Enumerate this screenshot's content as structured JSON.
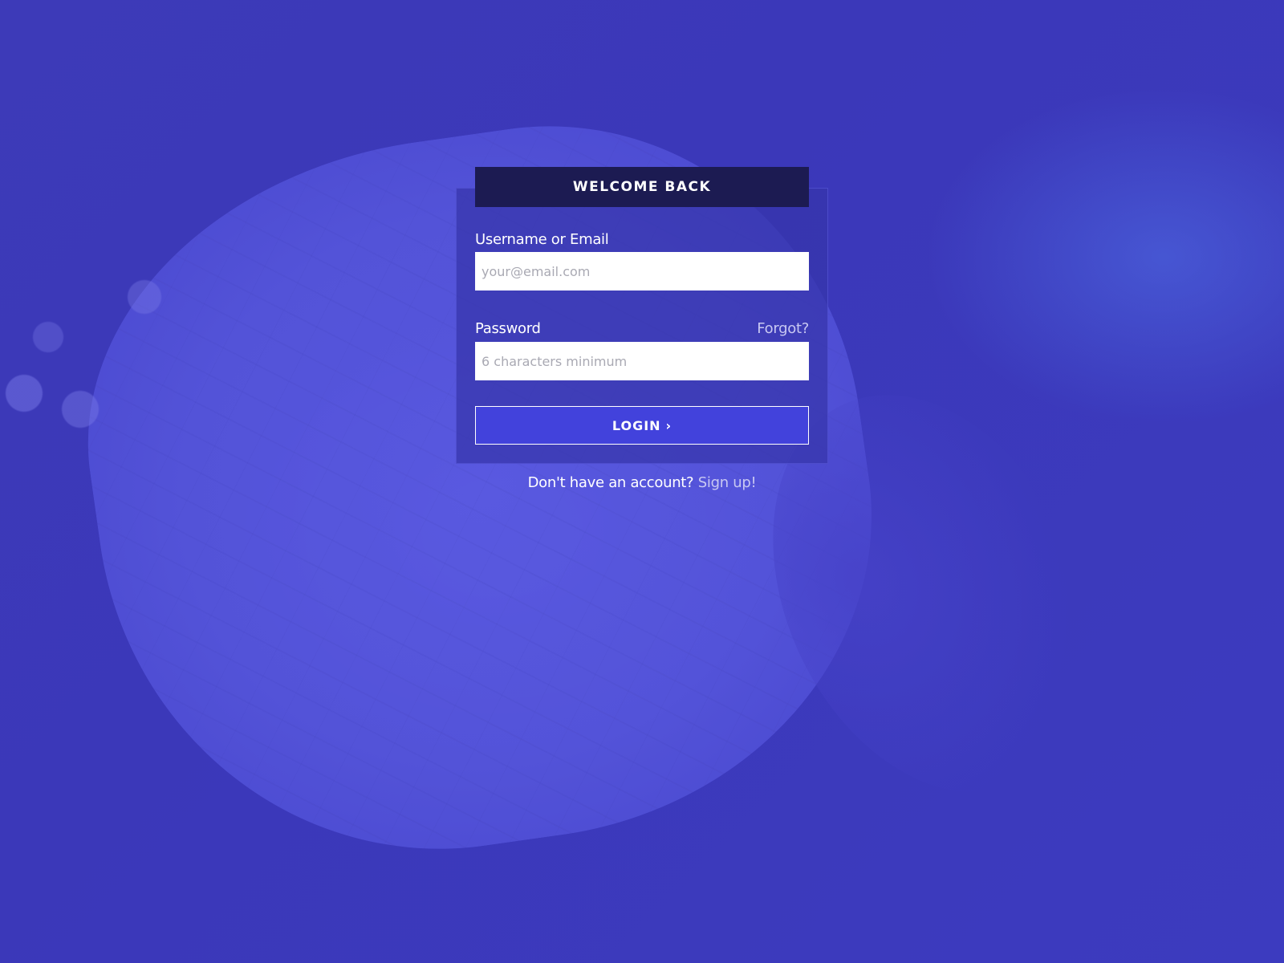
{
  "login_form": {
    "title": "WELCOME BACK",
    "username": {
      "label": "Username or Email",
      "placeholder": "your@email.com",
      "value": ""
    },
    "password": {
      "label": "Password",
      "placeholder": "6 characters minimum",
      "value": "",
      "forgot_label": "Forgot?"
    },
    "submit": {
      "label": "LOGIN",
      "arrow": "›"
    },
    "signup": {
      "prompt": "Don't have an account?",
      "link_label": "Sign up!"
    }
  },
  "colors": {
    "background": "#3b38b9",
    "header": "#1c1b52",
    "button": "#4242dc",
    "link": "#c8c8f2"
  }
}
